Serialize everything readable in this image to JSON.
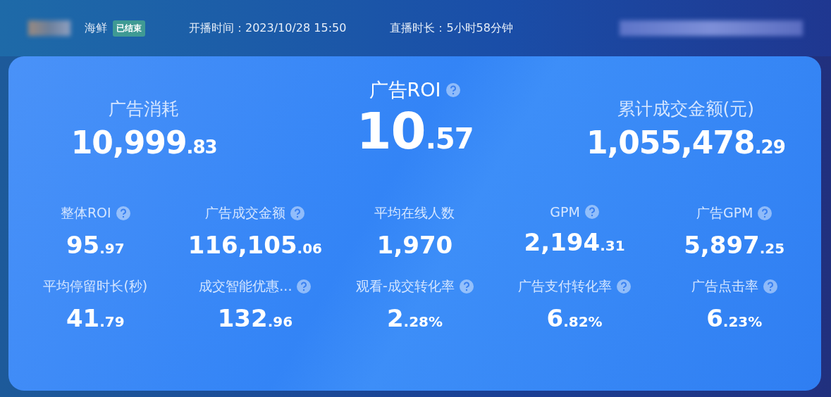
{
  "header": {
    "name": "海鲜",
    "status_badge": "已结束",
    "start_time": "开播时间：2023/10/28 15:50",
    "duration": "直播时长：5小时58分钟"
  },
  "main_metrics": [
    {
      "label": "广告消耗",
      "help": false,
      "int": "10,999",
      "dec": ".83",
      "kind": "side"
    },
    {
      "label": "广告ROI",
      "help": true,
      "int": "10",
      "dec": ".57",
      "kind": "center"
    },
    {
      "label": "累计成交金额(元)",
      "help": false,
      "int": "1,055,478",
      "dec": ".29",
      "kind": "side"
    }
  ],
  "metrics": [
    {
      "label": "整体ROI",
      "help": true,
      "int": "95",
      "dec": ".97"
    },
    {
      "label": "广告成交金额",
      "help": true,
      "int": "116,105",
      "dec": ".06"
    },
    {
      "label": "平均在线人数",
      "help": false,
      "int": "1,970"
    },
    {
      "label": "GPM",
      "help": true,
      "int": "2,194",
      "dec": ".31"
    },
    {
      "label": "广告GPM",
      "help": true,
      "int": "5,897",
      "dec": ".25"
    },
    {
      "label": "平均停留时长(秒)",
      "help": false,
      "int": "41",
      "dec": ".79"
    },
    {
      "label": "成交智能优惠...",
      "help": true,
      "int": "132",
      "dec": ".96"
    },
    {
      "label": "观看-成交转化率",
      "help": true,
      "int": "2",
      "dec": ".28%"
    },
    {
      "label": "广告支付转化率",
      "help": true,
      "int": "6",
      "dec": ".82%"
    },
    {
      "label": "广告点击率",
      "help": true,
      "int": "6",
      "dec": ".23%"
    }
  ]
}
